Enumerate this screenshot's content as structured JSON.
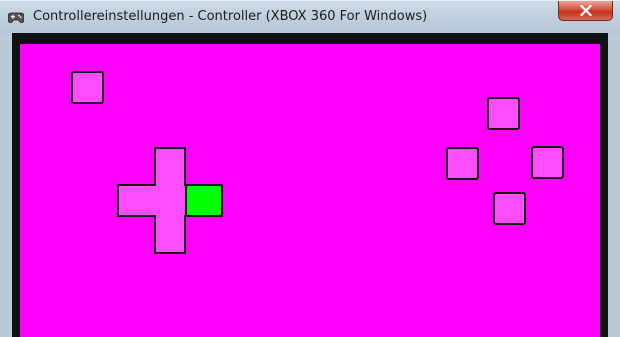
{
  "window": {
    "title": "Controllereinstellungen - Controller (XBOX 360 For Windows)"
  },
  "icons": {
    "title": "gamepad-icon",
    "close": "close-icon"
  },
  "colors": {
    "canvas_background": "#ff00ff",
    "button_fill": "#ff4dff",
    "button_border": "#1a1a1a",
    "active_button": "#00ff00",
    "close_button": "#c9412a"
  },
  "controller": {
    "dpad": {
      "up": "inactive",
      "down": "inactive",
      "left": "inactive",
      "right": "active"
    },
    "face_buttons": {
      "top": "inactive",
      "left": "inactive",
      "right": "inactive",
      "bottom": "inactive"
    },
    "top_left_button": "inactive"
  }
}
